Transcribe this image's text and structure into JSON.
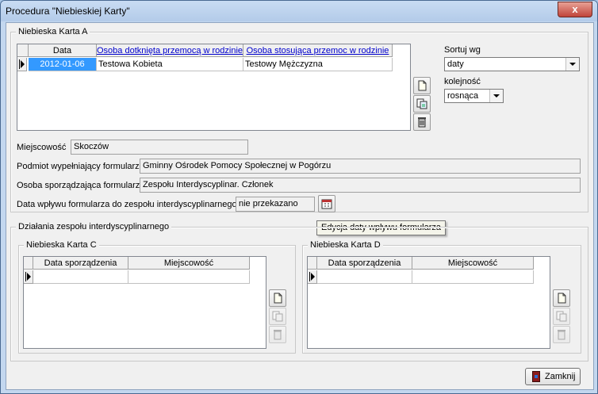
{
  "window": {
    "title": "Procedura \"Niebieskiej Karty\"",
    "close_glyph": "x"
  },
  "karta_a": {
    "group_label": "Niebieska Karta A",
    "columns": [
      "Data",
      "Osoba dotknięta przemocą w rodzinie",
      "Osoba stosująca przemoc w rodzinie"
    ],
    "rows": [
      {
        "data": "2012-01-06",
        "ofiara": "Testowa Kobieta",
        "sprawca": "Testowy Mężczyzna"
      }
    ]
  },
  "sort": {
    "label": "Sortuj wg",
    "value": "daty",
    "order_label": "kolejność",
    "order_value": "rosnąca"
  },
  "fields": {
    "miejscowosc_label": "Miejscowość",
    "miejscowosc_value": "Skoczów",
    "podmiot_label": "Podmiot wypełniający formularz",
    "podmiot_value": "Gminny Ośrodek Pomocy Społecznej w Pogórzu",
    "osoba_label": "Osoba sporządzająca formularz",
    "osoba_value": "Zespołu Interdyscyplinar. Członek",
    "data_wplywu_label": "Data wpływu formularza do zespołu interdyscyplinarnego",
    "data_wplywu_value": "nie przekazano"
  },
  "tooltip": "Edycja daty wpływu formularza",
  "dzialania": {
    "group_label": "Działania zespołu interdyscyplinarnego"
  },
  "karta_c": {
    "group_label": "Niebieska Karta C",
    "columns": [
      "Data sporządzenia",
      "Miejscowość"
    ]
  },
  "karta_d": {
    "group_label": "Niebieska Karta D",
    "columns": [
      "Data sporządzenia",
      "Miejscowość"
    ]
  },
  "footer": {
    "close_label": "Zamknij"
  },
  "icons": {
    "new": "new-document-icon",
    "edit": "edit-document-icon",
    "delete": "trash-icon",
    "calendar": "calendar-icon",
    "exit": "exit-door-icon"
  }
}
